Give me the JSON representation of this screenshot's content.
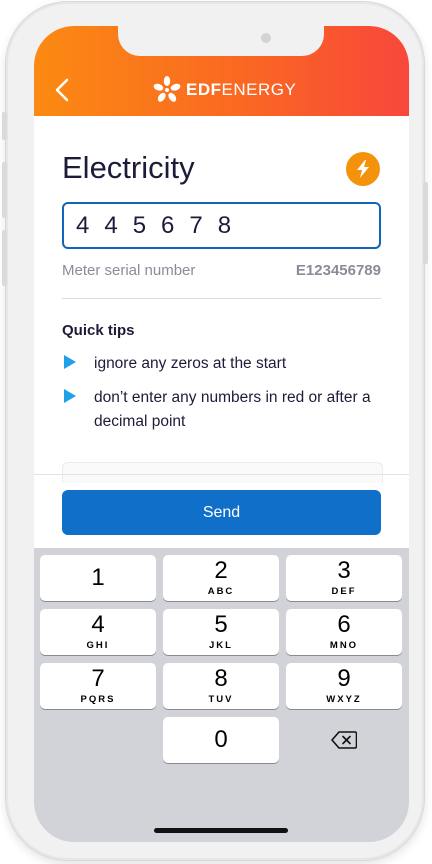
{
  "header": {
    "brand_prefix": "EDF",
    "brand_suffix": "ENERGY",
    "gradient_colors": [
      "#fb8a12",
      "#fa6822",
      "#f8473a"
    ]
  },
  "main": {
    "title": "Electricity",
    "reading_value": "445678",
    "serial_label": "Meter serial number",
    "serial_value": "E123456789",
    "tips_title": "Quick tips",
    "tips": [
      "ignore any zeros at the start",
      "don’t enter any numbers in red or after a decimal point"
    ],
    "accent_color": "#1366b7"
  },
  "send_button": {
    "label": "Send",
    "color": "#0f6fc9"
  },
  "keypad": {
    "keys": [
      {
        "digit": "1",
        "letters": ""
      },
      {
        "digit": "2",
        "letters": "ABC"
      },
      {
        "digit": "3",
        "letters": "DEF"
      },
      {
        "digit": "4",
        "letters": "GHI"
      },
      {
        "digit": "5",
        "letters": "JKL"
      },
      {
        "digit": "6",
        "letters": "MNO"
      },
      {
        "digit": "7",
        "letters": "PQRS"
      },
      {
        "digit": "8",
        "letters": "TUV"
      },
      {
        "digit": "9",
        "letters": "WXYZ"
      },
      {
        "digit": "0",
        "letters": ""
      }
    ],
    "delete_icon": "backspace-icon"
  }
}
